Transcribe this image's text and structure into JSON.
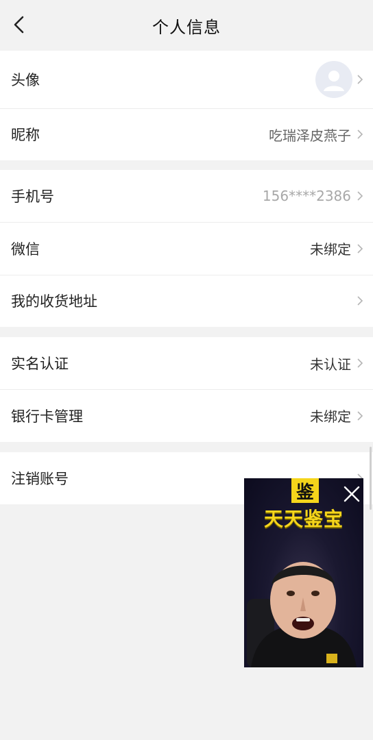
{
  "nav": {
    "title": "个人信息",
    "back_icon": "chevron-left-icon"
  },
  "groups": [
    {
      "rows": [
        {
          "label": "头像",
          "value": "",
          "type": "avatar"
        },
        {
          "label": "昵称",
          "value": "吃瑞泽皮燕子",
          "type": "text"
        }
      ]
    },
    {
      "rows": [
        {
          "label": "手机号",
          "value": "156****2386",
          "type": "muted"
        },
        {
          "label": "微信",
          "value": "未绑定",
          "type": "text"
        },
        {
          "label": "我的收货地址",
          "value": "",
          "type": "text"
        }
      ]
    },
    {
      "rows": [
        {
          "label": "实名认证",
          "value": "未认证",
          "type": "text"
        },
        {
          "label": "银行卡管理",
          "value": "未绑定",
          "type": "text"
        }
      ]
    },
    {
      "rows": [
        {
          "label": "注销账号",
          "value": "",
          "type": "text"
        }
      ]
    }
  ],
  "pip": {
    "logo_char": "鉴",
    "brand": "天天鉴宝",
    "close_icon": "close-icon"
  },
  "colors": {
    "background": "#f2f2f2",
    "row_background": "#ffffff",
    "brand_yellow": "#f5d51b",
    "muted_text": "#a8a8a8"
  }
}
